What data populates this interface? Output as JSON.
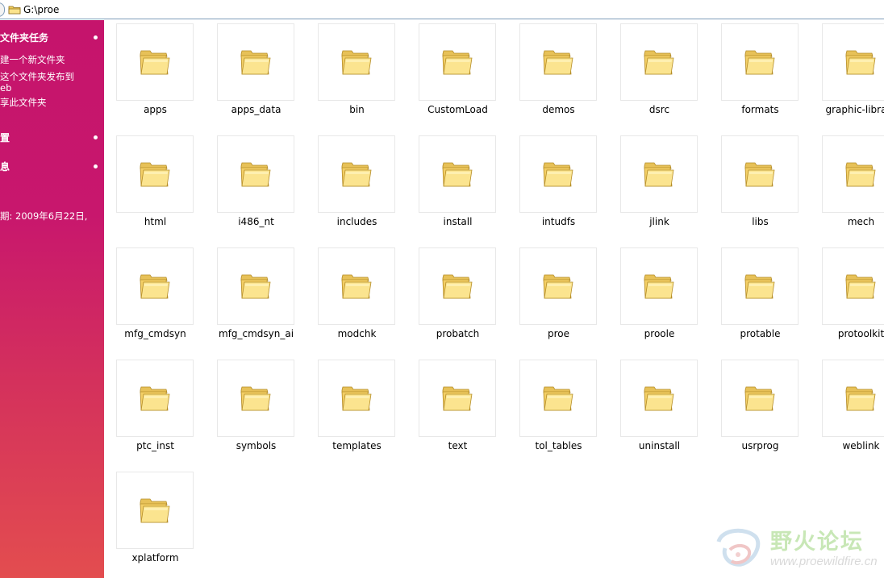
{
  "address_bar": {
    "path": "G:\\proe",
    "icon": "folder-icon"
  },
  "sidebar": {
    "tasks": {
      "title": "文件夹任务",
      "links": [
        "建一个新文件夹",
        "这个文件夹发布到",
        "eb",
        "享此文件夹"
      ]
    },
    "other_places": {
      "title": "置"
    },
    "details": {
      "title": "息",
      "date_text": "期: 2009年6月22日,"
    }
  },
  "folders": [
    "apps",
    "apps_data",
    "bin",
    "CustomLoad",
    "demos",
    "dsrc",
    "formats",
    "graphic-library",
    "html",
    "i486_nt",
    "includes",
    "install",
    "intudfs",
    "jlink",
    "libs",
    "mech",
    "mfg_cmdsyn",
    "mfg_cmdsyn_ai",
    "modchk",
    "probatch",
    "proe",
    "proole",
    "protable",
    "protoolkit",
    "ptc_inst",
    "symbols",
    "templates",
    "text",
    "tol_tables",
    "uninstall",
    "usrprog",
    "weblink",
    "xplatform"
  ],
  "watermark": {
    "title": "野火论坛",
    "url": "www.proewildfire.cn"
  },
  "colors": {
    "sidebar_top": "#c5146c",
    "sidebar_bottom": "#e34d4f",
    "folder": "#f5d86b"
  }
}
